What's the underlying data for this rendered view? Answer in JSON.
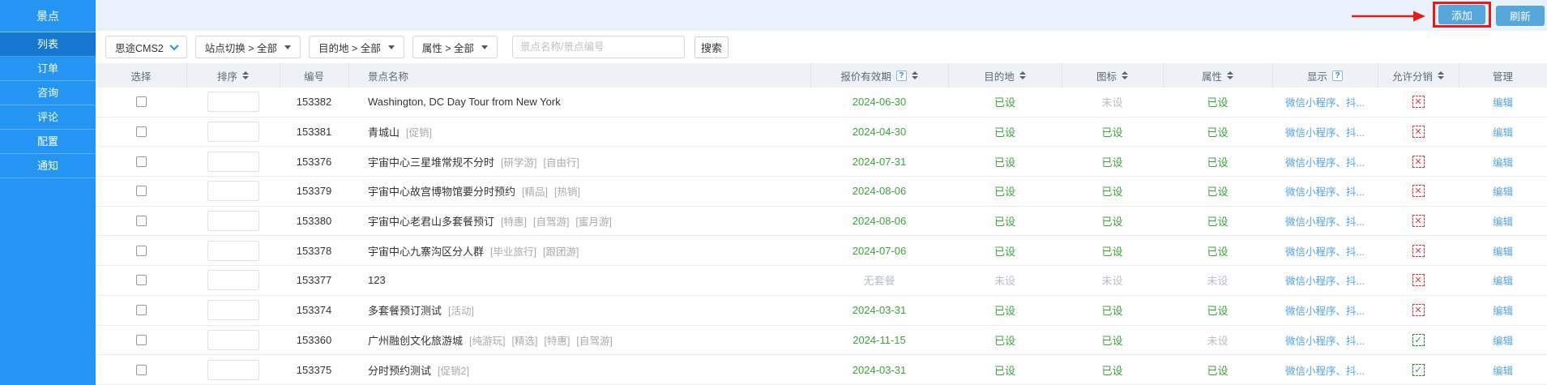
{
  "colors": {
    "accent": "#2595f4",
    "accent_dark": "#1677d0",
    "green": "#3fa03f",
    "red_annotation": "#e51c1c",
    "link_blue": "#55a3df",
    "button_blue": "#55a6da"
  },
  "sidebar": {
    "title": "景点",
    "items": [
      {
        "label": "列表",
        "active": true
      },
      {
        "label": "订单",
        "active": false
      },
      {
        "label": "咨询",
        "active": false
      },
      {
        "label": "评论",
        "active": false
      },
      {
        "label": "配置",
        "active": false
      },
      {
        "label": "通知",
        "active": false
      }
    ]
  },
  "header_actions": {
    "add": "添加",
    "refresh": "刷新"
  },
  "toolbar": {
    "site_select": "思途CMS2",
    "filters": [
      "站点切换 > 全部",
      "目的地 > 全部",
      "属性 > 全部"
    ],
    "search": {
      "placeholder": "景点名称/景点编号",
      "button": "搜索"
    }
  },
  "icons": {
    "cross": "✕",
    "check": "✓"
  },
  "table": {
    "columns": [
      {
        "label": "选择"
      },
      {
        "label": "排序",
        "sortable": true
      },
      {
        "label": "编号"
      },
      {
        "label": "景点名称"
      },
      {
        "label": "报价有效期",
        "sortable": true,
        "help": true
      },
      {
        "label": "目的地",
        "sortable": true
      },
      {
        "label": "图标",
        "sortable": true
      },
      {
        "label": "属性",
        "sortable": true
      },
      {
        "label": "显示",
        "help": true
      },
      {
        "label": "允许分销",
        "sortable": true
      },
      {
        "label": "管理"
      }
    ],
    "rows": [
      {
        "id": "153382",
        "name": "Washington, DC Day Tour from New York",
        "tags": [],
        "valid": {
          "text": "2024-06-30",
          "set": true
        },
        "destination": {
          "text": "已设",
          "set": true
        },
        "icon": {
          "text": "未设",
          "set": false
        },
        "attribute": {
          "text": "已设",
          "set": true
        },
        "display": "微信小程序、抖...",
        "distribution": "no",
        "manage": "编辑"
      },
      {
        "id": "153381",
        "name": "青城山",
        "tags": [
          "[促销]"
        ],
        "valid": {
          "text": "2024-04-30",
          "set": true
        },
        "destination": {
          "text": "已设",
          "set": true
        },
        "icon": {
          "text": "已设",
          "set": true
        },
        "attribute": {
          "text": "已设",
          "set": true
        },
        "display": "微信小程序、抖...",
        "distribution": "no",
        "manage": "编辑"
      },
      {
        "id": "153376",
        "name": "宇宙中心三星堆常规不分时",
        "tags": [
          "[研学游]",
          "[自由行]"
        ],
        "valid": {
          "text": "2024-07-31",
          "set": true
        },
        "destination": {
          "text": "已设",
          "set": true
        },
        "icon": {
          "text": "已设",
          "set": true
        },
        "attribute": {
          "text": "已设",
          "set": true
        },
        "display": "微信小程序、抖...",
        "distribution": "no",
        "manage": "编辑"
      },
      {
        "id": "153379",
        "name": "宇宙中心故宫博物馆要分时预约",
        "tags": [
          "[精品]",
          "[热销]"
        ],
        "valid": {
          "text": "2024-08-06",
          "set": true
        },
        "destination": {
          "text": "已设",
          "set": true
        },
        "icon": {
          "text": "已设",
          "set": true
        },
        "attribute": {
          "text": "已设",
          "set": true
        },
        "display": "微信小程序、抖...",
        "distribution": "no",
        "manage": "编辑"
      },
      {
        "id": "153380",
        "name": "宇宙中心老君山多套餐预订",
        "tags": [
          "[特惠]",
          "[自驾游]",
          "[蜜月游]"
        ],
        "valid": {
          "text": "2024-08-06",
          "set": true
        },
        "destination": {
          "text": "已设",
          "set": true
        },
        "icon": {
          "text": "已设",
          "set": true
        },
        "attribute": {
          "text": "已设",
          "set": true
        },
        "display": "微信小程序、抖...",
        "distribution": "no",
        "manage": "编辑"
      },
      {
        "id": "153378",
        "name": "宇宙中心九寨沟区分人群",
        "tags": [
          "[毕业旅行]",
          "[跟团游]"
        ],
        "valid": {
          "text": "2024-07-06",
          "set": true
        },
        "destination": {
          "text": "已设",
          "set": true
        },
        "icon": {
          "text": "已设",
          "set": true
        },
        "attribute": {
          "text": "已设",
          "set": true
        },
        "display": "微信小程序、抖...",
        "distribution": "no",
        "manage": "编辑"
      },
      {
        "id": "153377",
        "name": "123",
        "tags": [],
        "valid": {
          "text": "无套餐",
          "set": false
        },
        "destination": {
          "text": "未设",
          "set": false
        },
        "icon": {
          "text": "未设",
          "set": false
        },
        "attribute": {
          "text": "未设",
          "set": false
        },
        "display": "微信小程序、抖...",
        "distribution": "no",
        "manage": "编辑"
      },
      {
        "id": "153374",
        "name": "多套餐预订测试",
        "tags": [
          "[活动]"
        ],
        "valid": {
          "text": "2024-03-31",
          "set": true
        },
        "destination": {
          "text": "已设",
          "set": true
        },
        "icon": {
          "text": "已设",
          "set": true
        },
        "attribute": {
          "text": "已设",
          "set": true
        },
        "display": "微信小程序、抖...",
        "distribution": "no",
        "manage": "编辑"
      },
      {
        "id": "153360",
        "name": "广州融创文化旅游城",
        "tags": [
          "[纯游玩]",
          "[精选]",
          "[特惠]",
          "[自驾游]"
        ],
        "valid": {
          "text": "2024-11-15",
          "set": true
        },
        "destination": {
          "text": "已设",
          "set": true
        },
        "icon": {
          "text": "已设",
          "set": true
        },
        "attribute": {
          "text": "未设",
          "set": false
        },
        "display": "微信小程序、抖...",
        "distribution": "yes",
        "manage": "编辑"
      },
      {
        "id": "153375",
        "name": "分时预约测试",
        "tags": [
          "[促销2]"
        ],
        "valid": {
          "text": "2024-03-31",
          "set": true
        },
        "destination": {
          "text": "已设",
          "set": true
        },
        "icon": {
          "text": "已设",
          "set": true
        },
        "attribute": {
          "text": "已设",
          "set": true
        },
        "display": "微信小程序、抖...",
        "distribution": "yes",
        "manage": "编辑"
      }
    ]
  }
}
